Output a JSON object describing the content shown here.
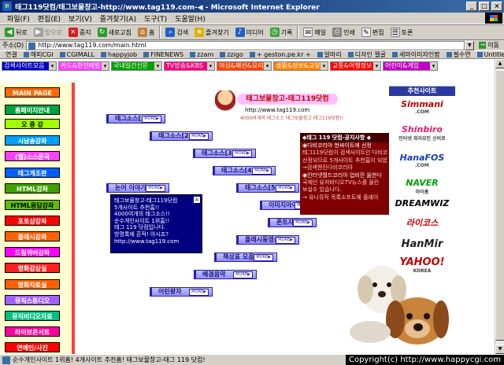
{
  "window": {
    "title": "태그119닷컴/태그보물창고-http://www.tag119.com-◀ - Microsoft Internet Explorer",
    "controls": [
      "_",
      "□",
      "×"
    ]
  },
  "menu": [
    "파일(F)",
    "편집(E)",
    "보기(V)",
    "즐겨찾기(A)",
    "도구(T)",
    "도움말(H)"
  ],
  "toolbar": [
    {
      "label": "뒤로",
      "icon": "back-arrow-icon"
    },
    {
      "label": "앞으로",
      "icon": "forward-arrow-icon"
    },
    {
      "label": "중지",
      "icon": "stop-icon"
    },
    {
      "label": "새로고침",
      "icon": "refresh-icon"
    },
    {
      "label": "홈",
      "icon": "home-icon"
    },
    {
      "label": "검색",
      "icon": "search-icon"
    },
    {
      "label": "즐겨찾기",
      "icon": "favorites-icon"
    },
    {
      "label": "미디어",
      "icon": "media-icon"
    },
    {
      "label": "기록",
      "icon": "history-icon"
    },
    {
      "label": "메일",
      "icon": "mail-icon"
    },
    {
      "label": "인쇄",
      "icon": "print-icon"
    },
    {
      "label": "편집",
      "icon": "edit-icon"
    },
    {
      "label": "토론",
      "icon": "discuss-icon"
    }
  ],
  "address": {
    "label": "주소(D)",
    "url": "http://www.tag119.com/main.html",
    "go": "이동"
  },
  "links": [
    "연결",
    "해피CGI",
    "CGIMALL",
    "happyjob",
    "FINENEWS",
    "zzam",
    "zzigo",
    "+ geston.pe.kr +",
    "알마리",
    "디자인 젤골",
    "세마이미자인팝",
    "필수연",
    "Untitled Document"
  ],
  "categories": [
    {
      "label": "검색사이트모음",
      "color": "#0000c0",
      "width": 70
    },
    {
      "label": "카드&한민메일",
      "color": "#ff40ff",
      "width": 65
    },
    {
      "label": "국내일간신문",
      "color": "#00a000",
      "width": 65
    },
    {
      "label": "TV방송&KBS",
      "color": "#ff0080",
      "width": 65
    },
    {
      "label": "여성&패션&요리",
      "color": "#ff4000",
      "width": 70
    },
    {
      "label": "생활&정보&교양",
      "color": "#ff8000",
      "width": 70
    },
    {
      "label": "교통&여행정보",
      "color": "#ff0000",
      "width": 65
    },
    {
      "label": "어린이&게임",
      "color": "#c000c0",
      "width": 70
    }
  ],
  "nav": [
    {
      "label": "MAIN PAGE",
      "bg": "#ff6a00",
      "color": "#ffffff"
    },
    {
      "label": "홈페이지안내",
      "bg": "#00a040",
      "color": "#ffffff"
    },
    {
      "label": "오 증 강",
      "bg": "#a0ff00",
      "color": "#000000"
    },
    {
      "label": "시남송강좌",
      "bg": "#00a0ff",
      "color": "#ffffff"
    },
    {
      "label": "(웹)소스문곡",
      "bg": "#ff40ff",
      "color": "#ffffff"
    },
    {
      "label": "태그게조판",
      "bg": "#0060ff",
      "color": "#ffffff"
    },
    {
      "label": "HTML강좌",
      "bg": "#40a000",
      "color": "#ffffff"
    },
    {
      "label": "HTML응답강좌",
      "bg": "#60c000",
      "color": "#000000"
    },
    {
      "label": "포토샵강좌",
      "bg": "#ff0000",
      "color": "#ffffff"
    },
    {
      "label": "플래시강좌",
      "bg": "#ff6000",
      "color": "#ffffff"
    },
    {
      "label": "드림위버강좌",
      "bg": "#ff00ff",
      "color": "#ffffff"
    },
    {
      "label": "명화감상실",
      "bg": "#ff2020",
      "color": "#ffffff"
    },
    {
      "label": "명화자료실",
      "bg": "#ff6000",
      "color": "#ffffff"
    },
    {
      "label": "뮤직스튜디오",
      "bg": "#a060ff",
      "color": "#ffffff"
    },
    {
      "label": "뮤직비디오자료",
      "bg": "#00c080",
      "color": "#ffffff"
    },
    {
      "label": "라이브콘서트",
      "bg": "#ff00a0",
      "color": "#ffffff"
    },
    {
      "label": "연예인/사진",
      "bg": "#ff0000",
      "color": "#ffffff"
    }
  ],
  "more_label": "MORE▶",
  "tags": [
    {
      "label": "태그소스[1]",
      "more": true
    },
    {
      "label": "태그소스[2]",
      "more": true
    },
    {
      "label": "태그소스[3]",
      "more": true
    },
    {
      "label": "태그소스[4]",
      "more": true
    },
    {
      "label": "태그소스[5]",
      "more": true
    },
    {
      "label": "논어 이야기",
      "more": true
    },
    {
      "label": "이미지아이콘",
      "more": true
    },
    {
      "label": "폰트자료",
      "more": true
    },
    {
      "label": "플래시동영상",
      "more": true
    },
    {
      "label": "책상표 모음",
      "more": true
    },
    {
      "label": "배경음악",
      "more": true
    },
    {
      "label": "어린왕자",
      "more": true
    }
  ],
  "popup": {
    "close": "×",
    "lines": [
      "태그보물창고-태그119닷컴",
      "5개사이트 추천홈!!",
      "4000여개의 태그소스!!",
      "순수개인사이트 1위홈!!",
      "태그 119 닷컴입니다.",
      "방명록에 흔적! 아시죠?",
      "http://www.tag119.com"
    ]
  },
  "banner": {
    "title": "태그보물창고-태그119닷컴",
    "url": "http://www.tag119.com",
    "sub": "4000여개의 태그소스 태그보물창고 태그119닷컴!!"
  },
  "notice": {
    "header": "◆태그 119 닷컴-공지사항 ◆",
    "lines": [
      {
        "text": "◉다비코리아 현싸이트에 선정",
        "bullet": true
      },
      {
        "text": "태그119닷컴이 검색사이트인 다비코",
        "bullet": false
      },
      {
        "text": "선정되므로 5개사이트 추천홈이 되었",
        "bullet": false
      },
      {
        "text": "→검색엔진다비코리아",
        "bullet": false
      },
      {
        "text": "◉인터넷월드코리아 업비전 올한다",
        "bullet": true
      },
      {
        "text": "국제인 유저비디오TV뉴스를 올린",
        "bullet": false
      },
      {
        "text": "보실수 있습니다.",
        "bullet": false
      },
      {
        "text": "→ 유니뮤직 목록소프트웨 플래이",
        "bullet": false
      }
    ]
  },
  "recommended": {
    "header": "추천사이트",
    "logos": [
      {
        "name": "Simmani",
        "sub": ".COM",
        "color": "#c00000",
        "bg": "#ffffff"
      },
      {
        "name": "Shinbiro",
        "sub": "인터넷 희리요인 신비로",
        "color": "#e0206a",
        "bg": "#ffffff"
      },
      {
        "name": "HanaFOS",
        "sub": ".COM",
        "color": "#1040c0",
        "bg": "#ffffff"
      },
      {
        "name": "NAVER",
        "sub": "마이홈",
        "color": "#00a000",
        "bg": "#ffffff"
      },
      {
        "name": "DREAMWIZ",
        "sub": "",
        "color": "#000000",
        "bg": "#ffffff"
      },
      {
        "name": "라이코스",
        "sub": "",
        "color": "#c00000",
        "bg": "#ffffff"
      },
      {
        "name": "HanMir",
        "sub": "",
        "color": "#202020",
        "bg": "#ffffff"
      },
      {
        "name": "YAHOO!",
        "sub": "KOREA",
        "color": "#c00000",
        "bg": "#ffffff"
      }
    ]
  },
  "status": {
    "text": "순수개인사이트 1위홈! 4개사이트 추천홈! 태그보물창고-태그 119 닷컴!",
    "copyright": "Copyright(c) http://www.happycgi.com"
  },
  "scroll": {
    "up": "▲",
    "down": "▼"
  }
}
